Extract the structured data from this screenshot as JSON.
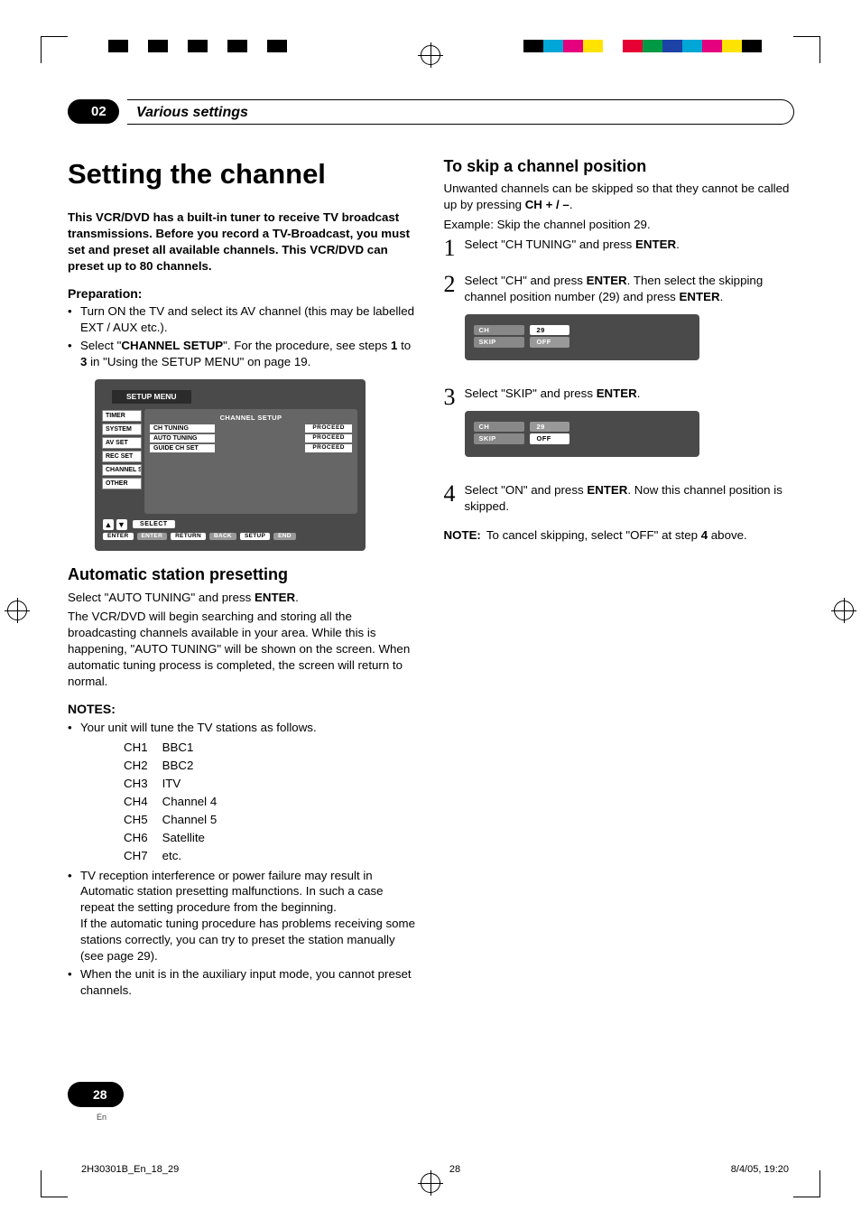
{
  "meta": {
    "domain": "Document"
  },
  "chapter": {
    "number": "02",
    "title": "Various settings"
  },
  "left": {
    "h1": "Setting the channel",
    "intro": "This VCR/DVD has a built-in tuner to receive TV broadcast transmissions. Before you record a TV-Broadcast, you must set and preset all available channels. This VCR/DVD can preset up to 80 channels.",
    "prep_h": "Preparation:",
    "prep_items": [
      "Turn ON the TV and select its AV channel (this may be labelled EXT / AUX etc.).",
      [
        "Select \"",
        "CHANNEL SETUP",
        "\". For the procedure, see steps ",
        "1",
        " to ",
        "3",
        " in \"Using the SETUP MENU\" on page 19."
      ]
    ],
    "osd": {
      "title": "SETUP MENU",
      "tabs": [
        "TIMER",
        "SYSTEM",
        "AV SET",
        "REC SET",
        "CHANNEL SETUP",
        "OTHER"
      ],
      "panel_hdr": "CHANNEL SETUP",
      "rows": [
        {
          "lbl": "CH TUNING",
          "proc": "PROCEED"
        },
        {
          "lbl": "AUTO TUNING",
          "proc": "PROCEED"
        },
        {
          "lbl": "GUIDE CH SET",
          "proc": "PROCEED"
        }
      ],
      "select": "SELECT",
      "footer": [
        "ENTER",
        "ENTER",
        "RETURN",
        "BACK",
        "SETUP",
        "END"
      ]
    },
    "auto_h": "Automatic station presetting",
    "auto_p1_pre": "Select \"AUTO TUNING\" and press ",
    "auto_p1_bold": "ENTER",
    "auto_p1_post": ".",
    "auto_p2": "The VCR/DVD will begin searching and storing all the broadcasting channels available in your area. While this is happening, \"AUTO TUNING\" will be shown on the screen. When automatic tuning process is completed, the screen will return to normal.",
    "notes_h": "NOTES:",
    "note1": "Your unit will tune the TV stations as follows.",
    "stations": [
      [
        "CH1",
        "BBC1"
      ],
      [
        "CH2",
        "BBC2"
      ],
      [
        "CH3",
        "ITV"
      ],
      [
        "CH4",
        "Channel 4"
      ],
      [
        "CH5",
        "Channel 5"
      ],
      [
        "CH6",
        "Satellite"
      ],
      [
        "CH7",
        "etc."
      ]
    ],
    "note2a": "TV reception interference or power failure may result in Automatic station presetting malfunctions. In such a case repeat the setting procedure from the beginning.",
    "note2b": "If the automatic tuning procedure has problems receiving some stations correctly, you can try to preset the station manually (see page 29).",
    "note3": "When the unit is in the auxiliary input mode, you cannot preset channels."
  },
  "right": {
    "h2": "To skip a channel position",
    "intro_pre": "Unwanted channels can be skipped so that they cannot be called up by pressing ",
    "intro_bold": "CH + / –",
    "intro_post": ".",
    "example": "Example: Skip the channel position 29.",
    "steps": [
      {
        "n": "1",
        "parts": [
          "Select \"CH TUNING\" and press ",
          "ENTER",
          "."
        ]
      },
      {
        "n": "2",
        "parts": [
          "Select \"CH\" and press ",
          "ENTER",
          ". Then select the skipping channel position number (29) and press ",
          "ENTER",
          "."
        ]
      },
      {
        "n": "3",
        "parts": [
          "Select \"SKIP\" and press ",
          "ENTER",
          "."
        ]
      },
      {
        "n": "4",
        "parts": [
          "Select \"ON\" and press ",
          "ENTER",
          ". Now this channel position is skipped."
        ]
      }
    ],
    "osd2": {
      "rows": [
        {
          "f": "CH",
          "v": "29",
          "sel": true
        },
        {
          "f": "SKIP",
          "v": "OFF",
          "sel": false
        }
      ]
    },
    "osd3": {
      "rows": [
        {
          "f": "CH",
          "v": "29",
          "sel": false
        },
        {
          "f": "SKIP",
          "v": "OFF",
          "sel": true
        }
      ]
    },
    "note": {
      "label": "NOTE:",
      "text_pre": "To cancel skipping, select \"OFF\" at step ",
      "bold": "4",
      "text_post": " above."
    }
  },
  "page": {
    "num": "28",
    "lang": "En"
  },
  "docfoot": {
    "file": "2H30301B_En_18_29",
    "page": "28",
    "date": "8/4/05, 19:20"
  }
}
